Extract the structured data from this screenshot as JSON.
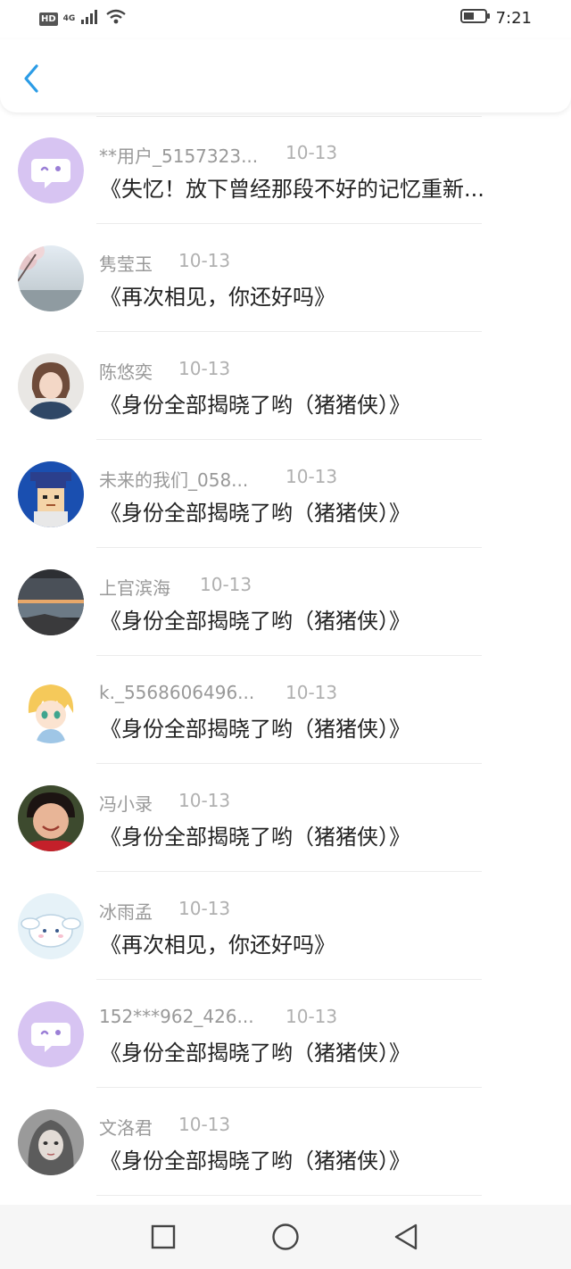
{
  "status_bar": {
    "hd": "HD",
    "network": "4G",
    "time": "7:21",
    "icons": [
      "signal-icon",
      "wifi-icon",
      "battery-icon"
    ]
  },
  "header": {
    "back_icon": "back-chevron-icon",
    "accent_color": "#2b9ce6"
  },
  "items": [
    {
      "user": "**用户_5157323...",
      "date": "10-13",
      "title": "《失忆！放下曾经那段不好的记忆重新...",
      "avatar": "default-chat-avatar"
    },
    {
      "user": "隽莹玉",
      "date": "10-13",
      "title": "《再次相见，你还好吗》",
      "avatar": "blossom-landscape-avatar"
    },
    {
      "user": "陈悠奕",
      "date": "10-13",
      "title": "《身份全部揭晓了哟（猪猪侠）》",
      "avatar": "girl-photo-avatar"
    },
    {
      "user": "未来的我们_058...",
      "date": "10-13",
      "title": "《身份全部揭晓了哟（猪猪侠）》",
      "avatar": "pixel-graduate-avatar"
    },
    {
      "user": "上官滨海",
      "date": "10-13",
      "title": "《身份全部揭晓了哟（猪猪侠）》",
      "avatar": "seaside-sunset-avatar"
    },
    {
      "user": "k._5568606496...",
      "date": "10-13",
      "title": "《身份全部揭晓了哟（猪猪侠）》",
      "avatar": "anime-boy-avatar"
    },
    {
      "user": "冯小录",
      "date": "10-13",
      "title": "《身份全部揭晓了哟（猪猪侠）》",
      "avatar": "child-photo-avatar"
    },
    {
      "user": "冰雨孟",
      "date": "10-13",
      "title": "《再次相见，你还好吗》",
      "avatar": "cinnamoroll-avatar"
    },
    {
      "user": "152***962_426...",
      "date": "10-13",
      "title": "《身份全部揭晓了哟（猪猪侠）》",
      "avatar": "default-chat-avatar"
    },
    {
      "user": "文洛君",
      "date": "10-13",
      "title": "《身份全部揭晓了哟（猪猪侠）》",
      "avatar": "illustrated-girl-avatar"
    }
  ],
  "nav_bar": {
    "icons": [
      "recent-apps-square-icon",
      "home-circle-icon",
      "back-triangle-icon"
    ]
  }
}
